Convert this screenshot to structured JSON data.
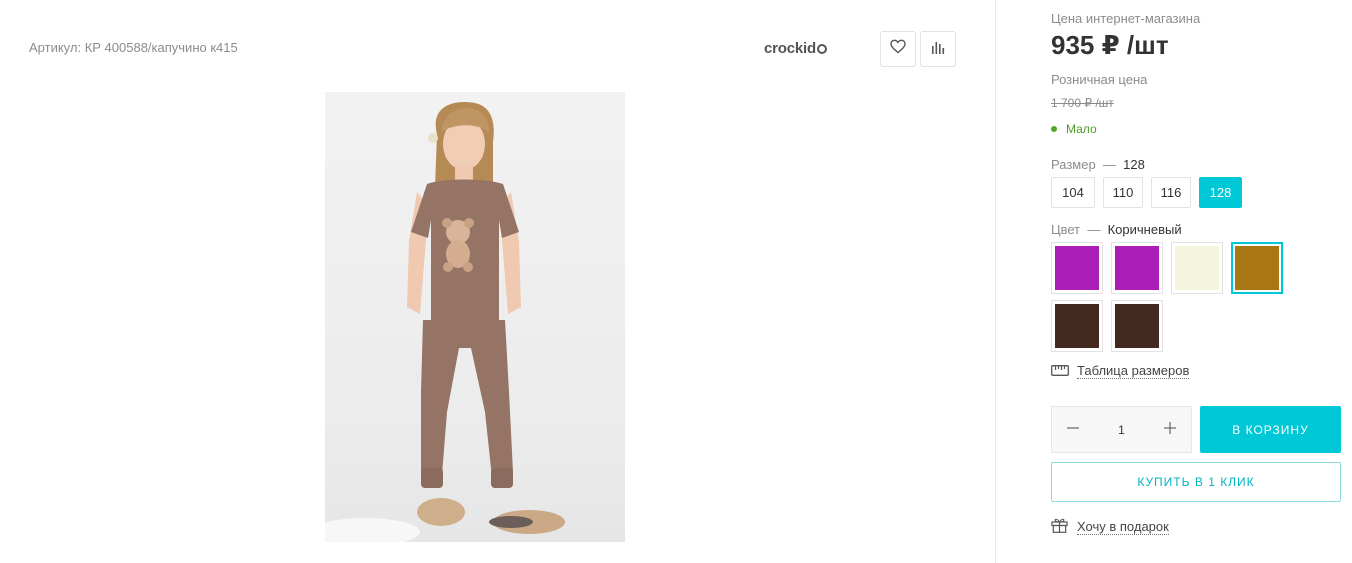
{
  "product": {
    "sku": "Артикул: КР 400588/капучино к415",
    "brand": "crockid"
  },
  "actions": {
    "favorite_icon": "heart-icon",
    "compare_icon": "bar-chart-icon"
  },
  "pricing": {
    "online_label": "Цена интернет-магазина",
    "online_price": "935 ₽ /шт",
    "retail_label": "Розничная цена",
    "retail_price": "1 700 ₽ /шт",
    "stock": "Мало"
  },
  "size": {
    "label": "Размер",
    "dash": "—",
    "selected": "128",
    "options": [
      "104",
      "110",
      "116",
      "128"
    ],
    "selected_index": 3
  },
  "color": {
    "label": "Цвет",
    "dash": "—",
    "selected": "Коричневый",
    "swatches": [
      "#aa1db6",
      "#aa1db6",
      "#f4f4dd",
      "#a87612",
      "#432820",
      "#432820"
    ],
    "selected_index": 3
  },
  "size_table": {
    "label": "Таблица размеров"
  },
  "quantity": {
    "value": "1"
  },
  "cart_button": "В КОРЗИНУ",
  "one_click_button": "КУПИТЬ В 1 КЛИК",
  "gift": {
    "label": "Хочу в подарок"
  },
  "colors": {
    "accent": "#00c8d7",
    "stock_green": "#4eaa26"
  }
}
